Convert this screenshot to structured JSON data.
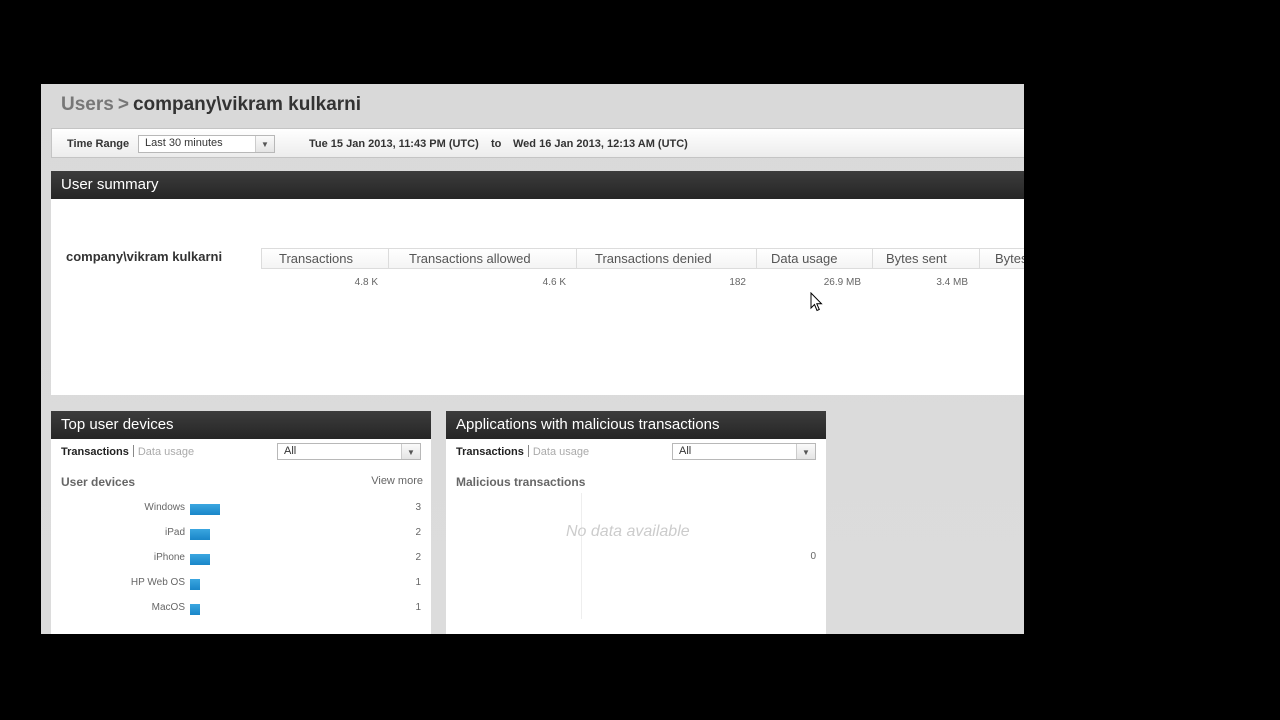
{
  "breadcrumb": {
    "parent": "Users",
    "separator": ">",
    "current": "company\\vikram kulkarni"
  },
  "time_range": {
    "label": "Time Range",
    "selected": "Last 30 minutes",
    "from": "Tue 15 Jan 2013, 11:43 PM (UTC)",
    "to_label": "to",
    "to": "Wed 16 Jan 2013, 12:13 AM (UTC)"
  },
  "summary": {
    "title": "User summary",
    "user": "company\\vikram kulkarni",
    "columns": [
      "Transactions",
      "Transactions allowed",
      "Transactions denied",
      "Data usage",
      "Bytes sent",
      "Bytes"
    ],
    "values": [
      "4.8 K",
      "4.6 K",
      "182",
      "26.9 MB",
      "3.4 MB",
      ""
    ]
  },
  "devices": {
    "title": "Top user devices",
    "tab_active": "Transactions",
    "tab_inactive": "Data usage",
    "filter": "All",
    "subhead": "User devices",
    "view_more": "View more",
    "items": [
      {
        "label": "Windows",
        "count": "3",
        "value": 3
      },
      {
        "label": "iPad",
        "count": "2",
        "value": 2
      },
      {
        "label": "iPhone",
        "count": "2",
        "value": 2
      },
      {
        "label": "HP Web OS",
        "count": "1",
        "value": 1
      },
      {
        "label": "MacOS",
        "count": "1",
        "value": 1
      }
    ]
  },
  "malicious": {
    "title": "Applications with malicious transactions",
    "tab_active": "Transactions",
    "tab_inactive": "Data usage",
    "filter": "All",
    "subhead": "Malicious transactions",
    "no_data": "No data available",
    "zero": "0"
  },
  "icons": {
    "dropdown": "chevron-down-icon",
    "cursor": "mouse-pointer-icon"
  }
}
